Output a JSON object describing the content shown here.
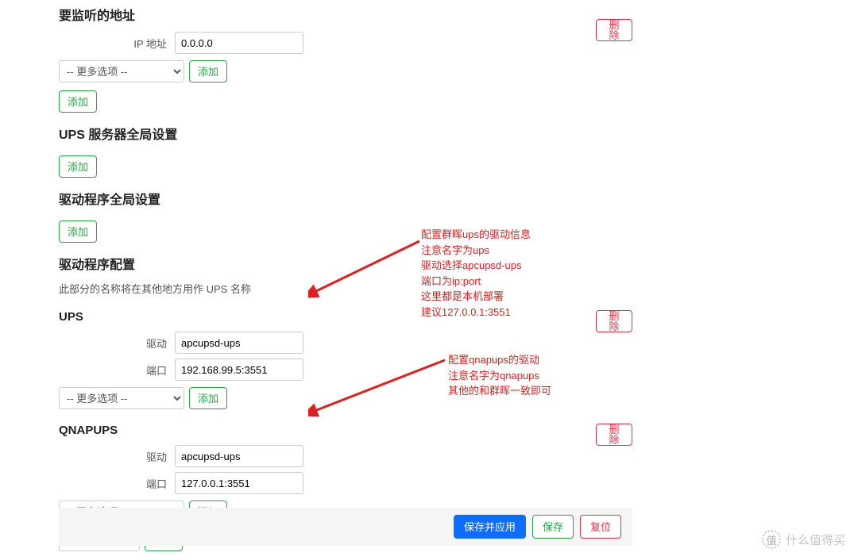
{
  "listen_section": {
    "title": "要监听的地址",
    "ip_label": "IP 地址",
    "ip_value": "0.0.0.0",
    "more_options": "-- 更多选项 --",
    "add": "添加",
    "delete": "删除"
  },
  "ups_server_section": {
    "title": "UPS 服务器全局设置",
    "add": "添加"
  },
  "driver_global_section": {
    "title": "驱动程序全局设置",
    "add": "添加"
  },
  "driver_config_section": {
    "title": "驱动程序配置",
    "hint": "此部分的名称将在其他地方用作 UPS 名称"
  },
  "ups_block": {
    "name": "UPS",
    "driver_label": "驱动",
    "driver_value": "apcupsd-ups",
    "port_label": "端口",
    "port_value": "192.168.99.5:3551",
    "more_options": "-- 更多选项 --",
    "add": "添加",
    "delete": "删除"
  },
  "qnap_block": {
    "name": "QNAPUPS",
    "driver_label": "驱动",
    "driver_value": "apcupsd-ups",
    "port_label": "端口",
    "port_value": "127.0.0.1:3551",
    "more_options": "-- 更多选项 --",
    "add": "添加",
    "delete": "删除"
  },
  "footer": {
    "save_apply": "保存并应用",
    "save": "保存",
    "reset": "复位"
  },
  "annotation1": {
    "l1": "配置群晖ups的驱动信息",
    "l2": "注意名字为ups",
    "l3": "驱动选择apcupsd-ups",
    "l4": "端口为ip:port",
    "l5": "这里都是本机部署",
    "l6": "建议127.0.0.1:3551"
  },
  "annotation2": {
    "l1": "配置qnapups的驱动",
    "l2": "注意名字为qnapups",
    "l3": "其他的和群晖一致即可"
  },
  "watermark": {
    "icon": "值",
    "text": "什么值得买"
  }
}
